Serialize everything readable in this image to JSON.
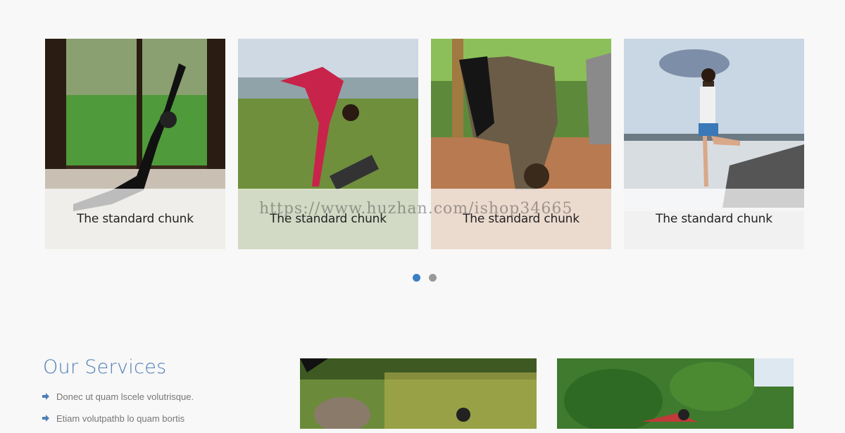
{
  "carousel": {
    "slides": [
      {
        "caption": "The standard chunk",
        "image": "yoga-low-lunge-indoors"
      },
      {
        "caption": "The standard chunk",
        "image": "yoga-forward-bend-red-pants"
      },
      {
        "caption": "The standard chunk",
        "image": "yoga-forward-fold-deck"
      },
      {
        "caption": "The standard chunk",
        "image": "yoga-tree-pose-lake"
      }
    ],
    "pagination": [
      {
        "active": true
      },
      {
        "active": false
      }
    ]
  },
  "watermark": "https://www.huzhan.com/ishop34665",
  "services": {
    "title": "Our Services",
    "items": [
      "Donec ut quam lscele volutrisque.",
      "Etiam volutpathb lo quam bortis"
    ]
  },
  "gallery": [
    {
      "image": "yoga-outdoor-bamboo"
    },
    {
      "image": "yoga-outdoor-trees"
    }
  ],
  "colors": {
    "accent": "#4e7fb6",
    "dot_active": "#3a7fc4",
    "dot_inactive": "#999999"
  }
}
